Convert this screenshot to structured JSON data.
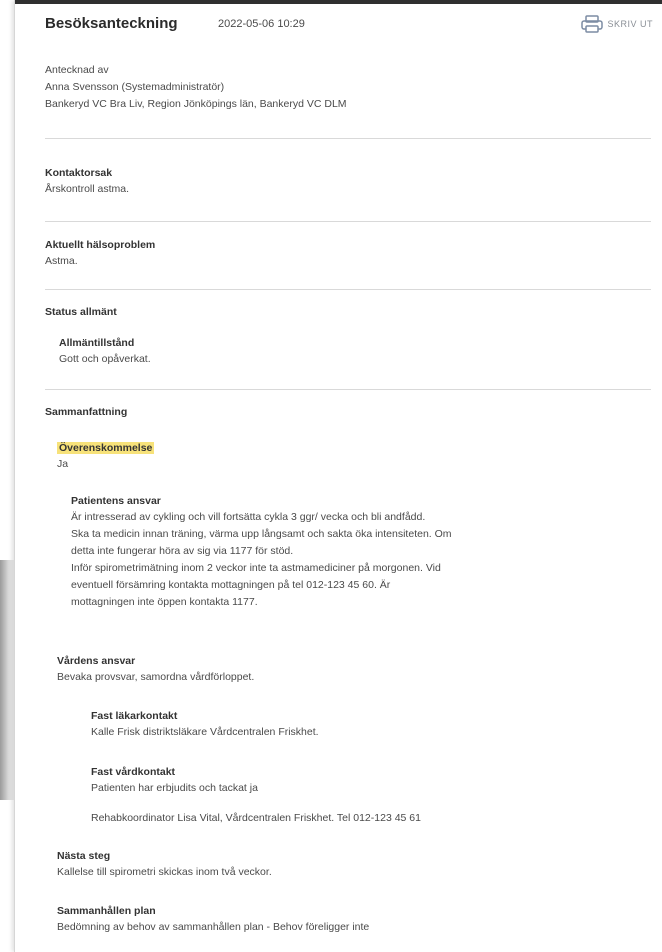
{
  "header": {
    "title": "Besöksanteckning",
    "timestamp": "2022-05-06 10:29",
    "print_label": "SKRIV UT"
  },
  "author": {
    "label": "Antecknad av",
    "name": "Anna Svensson (Systemadministratör)",
    "unit": "Bankeryd VC Bra Liv, Region Jönköpings län, Bankeryd VC DLM"
  },
  "contact_reason": {
    "label": "Kontaktorsak",
    "value": "Årskontroll astma."
  },
  "health_problem": {
    "label": "Aktuellt hälsoproblem",
    "value": "Astma."
  },
  "status": {
    "label": "Status allmänt",
    "sub_label": "Allmäntillstånd",
    "sub_value": "Gott och opåverkat."
  },
  "summary": {
    "label": "Sammanfattning",
    "agreement_label": "Överenskommelse",
    "agreement_value": "Ja",
    "patient_resp_label": "Patientens ansvar",
    "patient_resp_lines": [
      "Är intresserad av cykling och vill fortsätta cykla 3 ggr/ vecka och bli andfådd.",
      "Ska ta medicin innan träning, värma upp långsamt och sakta öka intensiteten. Om",
      "detta inte fungerar höra av sig via 1177 för stöd.",
      "Inför spirometrimätning inom 2 veckor inte ta astmamediciner på morgonen. Vid",
      "eventuell försämring kontakta mottagningen på tel 012-123 45 60. Är",
      "mottagningen inte öppen kontakta 1177."
    ],
    "care_resp_label": "Vårdens ansvar",
    "care_resp_value": "Bevaka provsvar, samordna vårdförloppet.",
    "doctor_label": "Fast läkarkontakt",
    "doctor_value": "Kalle Frisk distriktsläkare Vårdcentralen Friskhet.",
    "care_contact_label": "Fast vårdkontakt",
    "care_contact_value": "Patienten har erbjudits och tackat ja",
    "rehab_value": "Rehabkoordinator Lisa Vital, Vårdcentralen Friskhet. Tel 012-123 45 61",
    "next_step_label": "Nästa steg",
    "next_step_value": "Kallelse till spirometri skickas inom två veckor.",
    "plan_label": "Sammanhållen plan",
    "plan_value": "Bedömning av behov av sammanhållen plan - Behov föreligger inte"
  },
  "colors": {
    "highlight": "#f7e27a",
    "print_icon": "#7c8ca3"
  }
}
